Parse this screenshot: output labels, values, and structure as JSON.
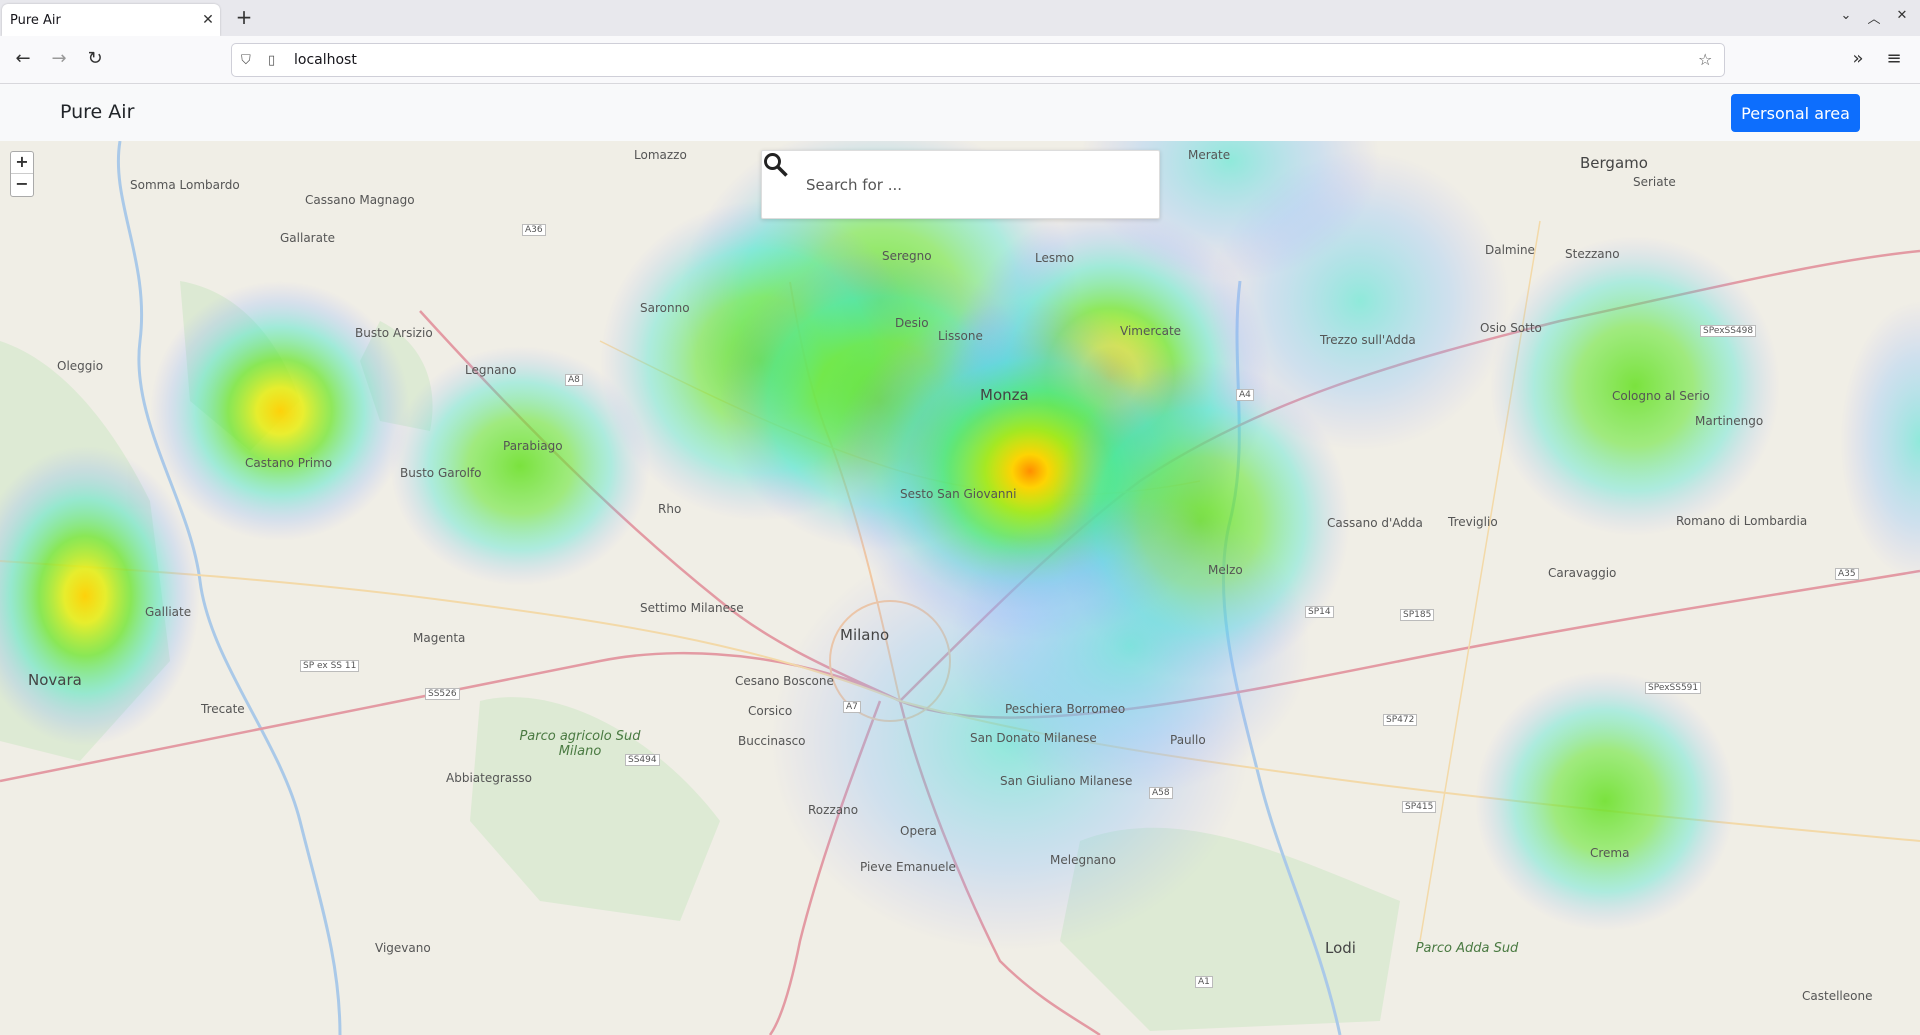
{
  "browser": {
    "tab_title": "Pure Air",
    "url": "localhost"
  },
  "header": {
    "brand": "Pure Air",
    "personal_area_label": "Personal area"
  },
  "search": {
    "placeholder": "Search for ..."
  },
  "map": {
    "zoom_in": "+",
    "zoom_out": "−",
    "labels": [
      {
        "text": "Milano",
        "kind": "city"
      },
      {
        "text": "Monza",
        "kind": "city"
      },
      {
        "text": "Bergamo",
        "kind": "city"
      },
      {
        "text": "Novara",
        "kind": "city"
      },
      {
        "text": "Lodi",
        "kind": "city"
      },
      {
        "text": "Crema",
        "kind": "town"
      },
      {
        "text": "Somma Lombardo",
        "kind": "town"
      },
      {
        "text": "Cassano Magnago",
        "kind": "town"
      },
      {
        "text": "Gallarate",
        "kind": "town"
      },
      {
        "text": "Busto Arsizio",
        "kind": "town"
      },
      {
        "text": "Legnano",
        "kind": "town"
      },
      {
        "text": "Saronno",
        "kind": "town"
      },
      {
        "text": "Seregno",
        "kind": "town"
      },
      {
        "text": "Lesmo",
        "kind": "town"
      },
      {
        "text": "Desio",
        "kind": "town"
      },
      {
        "text": "Lissone",
        "kind": "town"
      },
      {
        "text": "Vimercate",
        "kind": "town"
      },
      {
        "text": "Trezzo sull'Adda",
        "kind": "town"
      },
      {
        "text": "Osio Sotto",
        "kind": "town"
      },
      {
        "text": "Dalmine",
        "kind": "town"
      },
      {
        "text": "Treviglio",
        "kind": "town"
      },
      {
        "text": "Caravaggio",
        "kind": "town"
      },
      {
        "text": "Cassano d'Adda",
        "kind": "town"
      },
      {
        "text": "Melzo",
        "kind": "town"
      },
      {
        "text": "Sesto San Giovanni",
        "kind": "town"
      },
      {
        "text": "Rho",
        "kind": "town"
      },
      {
        "text": "Magenta",
        "kind": "town"
      },
      {
        "text": "Abbiategrasso",
        "kind": "town"
      },
      {
        "text": "Vigevano",
        "kind": "town"
      },
      {
        "text": "Pieve Emanuele",
        "kind": "town"
      },
      {
        "text": "Peschiera Borromeo",
        "kind": "town"
      },
      {
        "text": "San Donato Milanese",
        "kind": "town"
      },
      {
        "text": "San Giuliano Milanese",
        "kind": "town"
      },
      {
        "text": "Melegnano",
        "kind": "town"
      },
      {
        "text": "Paullo",
        "kind": "town"
      },
      {
        "text": "Corsico",
        "kind": "town"
      },
      {
        "text": "Buccinasco",
        "kind": "town"
      },
      {
        "text": "Rozzano",
        "kind": "town"
      },
      {
        "text": "Opera",
        "kind": "town"
      },
      {
        "text": "Cesano Boscone",
        "kind": "town"
      },
      {
        "text": "Settimo Milanese",
        "kind": "town"
      },
      {
        "text": "Trecate",
        "kind": "town"
      },
      {
        "text": "Galliate",
        "kind": "town"
      },
      {
        "text": "Oleggio",
        "kind": "town"
      },
      {
        "text": "Castano Primo",
        "kind": "town"
      },
      {
        "text": "Busto Garolfo",
        "kind": "town"
      },
      {
        "text": "Parabiago",
        "kind": "town"
      },
      {
        "text": "Cologno al Serio",
        "kind": "town"
      },
      {
        "text": "Martinengo",
        "kind": "town"
      },
      {
        "text": "Romano di Lombardia",
        "kind": "town"
      },
      {
        "text": "Castelleone",
        "kind": "town"
      },
      {
        "text": "Seriate",
        "kind": "town"
      },
      {
        "text": "Stezzano",
        "kind": "town"
      },
      {
        "text": "Merate",
        "kind": "town"
      },
      {
        "text": "Lomazzo",
        "kind": "town"
      },
      {
        "text": "Parco agricolo Sud Milano",
        "kind": "park"
      },
      {
        "text": "Parco Adda Sud",
        "kind": "park"
      },
      {
        "text": "A4",
        "kind": "road"
      },
      {
        "text": "A1",
        "kind": "road"
      },
      {
        "text": "A7",
        "kind": "road"
      },
      {
        "text": "A8",
        "kind": "road"
      },
      {
        "text": "A35",
        "kind": "road"
      },
      {
        "text": "A36",
        "kind": "road"
      },
      {
        "text": "A58",
        "kind": "road"
      },
      {
        "text": "SS494",
        "kind": "road"
      },
      {
        "text": "SS526",
        "kind": "road"
      },
      {
        "text": "SP ex SS 11",
        "kind": "road"
      },
      {
        "text": "SP14",
        "kind": "road"
      },
      {
        "text": "SP185",
        "kind": "road"
      },
      {
        "text": "SP472",
        "kind": "road"
      },
      {
        "text": "SP415",
        "kind": "road"
      },
      {
        "text": "SPexSS591",
        "kind": "road"
      },
      {
        "text": "SPexSS498",
        "kind": "road"
      }
    ]
  }
}
